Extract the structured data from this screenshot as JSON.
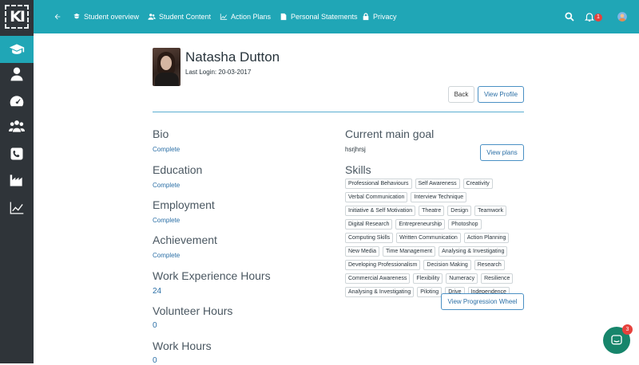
{
  "app": {
    "logo_text": "KI"
  },
  "topbar": {
    "nav": [
      {
        "label": "Student overview",
        "icon": "student-icon"
      },
      {
        "label": "Student Content",
        "icon": "users-icon"
      },
      {
        "label": "Action Plans",
        "icon": "chart-icon"
      },
      {
        "label": "Personal Statements",
        "icon": "document-icon"
      },
      {
        "label": "Privacy",
        "icon": "lock-icon"
      }
    ],
    "notification_count": "1"
  },
  "sidebar": {
    "items": [
      {
        "name": "graduation-cap-icon",
        "active": true
      },
      {
        "name": "user-icon"
      },
      {
        "name": "dashboard-icon"
      },
      {
        "name": "users-icon"
      },
      {
        "name": "phone-icon"
      },
      {
        "name": "factory-icon"
      },
      {
        "name": "line-chart-icon"
      }
    ]
  },
  "profile": {
    "name": "Natasha Dutton",
    "last_login": "Last Login: 20-03-2017",
    "back_label": "Back",
    "view_profile_label": "View Profile"
  },
  "sections": {
    "bio": {
      "title": "Bio",
      "status": "Complete"
    },
    "education": {
      "title": "Education",
      "status": "Complete"
    },
    "employment": {
      "title": "Employment",
      "status": "Complete"
    },
    "achievement": {
      "title": "Achievement",
      "status": "Complete"
    },
    "work_experience": {
      "title": "Work Experience Hours",
      "value": "24"
    },
    "volunteer": {
      "title": "Volunteer Hours",
      "value": "0"
    },
    "work_hours": {
      "title": "Work Hours",
      "value": "0"
    }
  },
  "goal": {
    "title": "Current main goal",
    "text": "hsrjhrsj",
    "view_plans_label": "View plans"
  },
  "skills": {
    "title": "Skills",
    "tags": [
      "Professional Behaviours",
      "Self Awareness",
      "Creativity",
      "Verbal Communication",
      "Interview Technique",
      "Initiative & Self Motivation",
      "Theatre",
      "Design",
      "Teamwork",
      "Digital Research",
      "Entrepreneurship",
      "Photoshop",
      "Computing Skills",
      "Written Communication",
      "Action Planning",
      "New Media",
      "Time Management",
      "Analysing & Investigating",
      "Developing Professionalism",
      "Decision Making",
      "Research",
      "Commercial Awareness",
      "Flexibility",
      "Numeracy",
      "Resilience",
      "Analysing & Investigating",
      "Piloting",
      "Drive",
      "Independence"
    ],
    "view_wheel_label": "View Progression Wheel"
  },
  "chat": {
    "badge": "3"
  },
  "colors": {
    "accent": "#20a6b6",
    "sidebar": "#2f3439",
    "link": "#2b6fa6",
    "badge": "#e6413c",
    "chat": "#17856b"
  }
}
